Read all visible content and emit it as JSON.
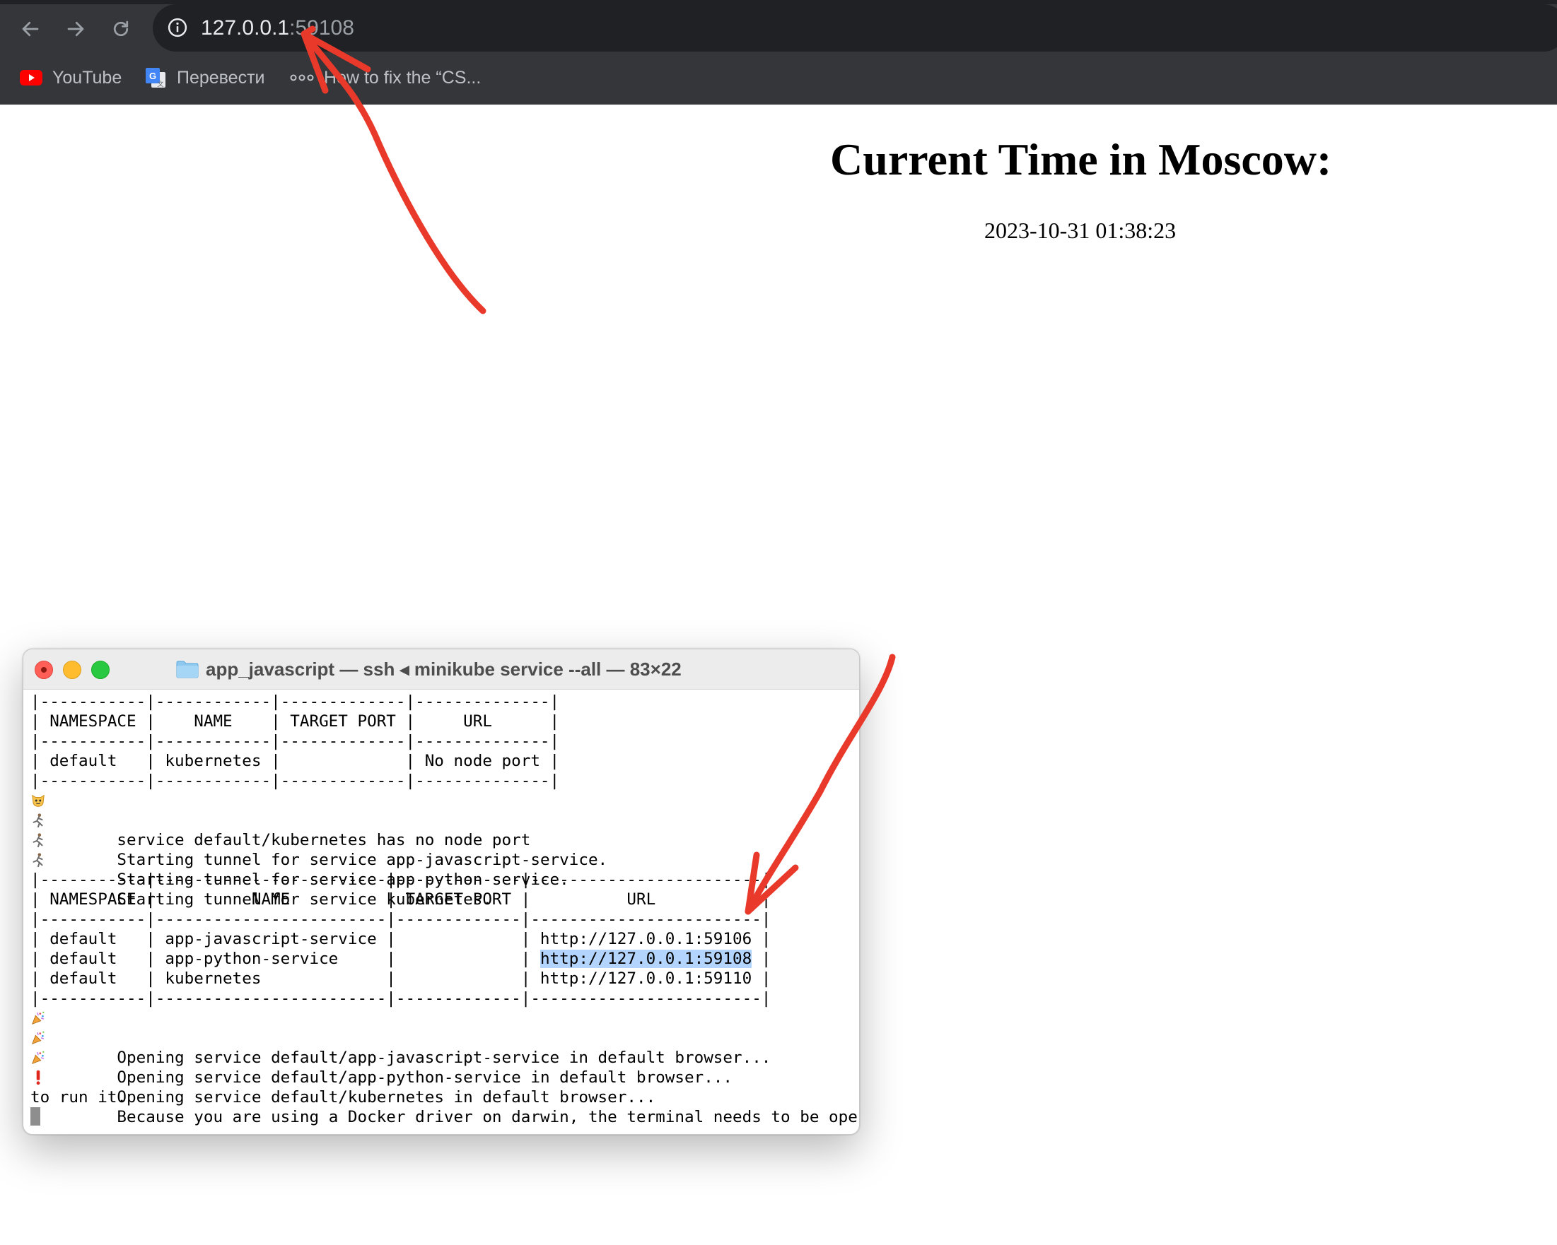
{
  "browser": {
    "url_host": "127.0.0.1",
    "url_port": ":59108",
    "bookmarks": [
      {
        "label": "YouTube",
        "icon": "youtube-icon"
      },
      {
        "label": "Перевести",
        "icon": "google-translate-icon"
      },
      {
        "label": "How to fix the “CS...",
        "icon": "ellipsis-icon"
      }
    ],
    "nav_icons": [
      "back-arrow-icon",
      "forward-arrow-icon",
      "reload-icon",
      "info-icon"
    ]
  },
  "page": {
    "heading": "Current Time in Moscow:",
    "time": "2023-10-31 01:38:23"
  },
  "terminal": {
    "title": "app_javascript — ssh ◂ minikube service --all — 83×22",
    "lines": [
      {
        "text": "|-----------|------------|-------------|--------------|"
      },
      {
        "text": "| NAMESPACE |    NAME    | TARGET PORT |     URL      |"
      },
      {
        "text": "|-----------|------------|-------------|--------------|"
      },
      {
        "text": "| default   | kubernetes |             | No node port |"
      },
      {
        "text": "|-----------|------------|-------------|--------------|"
      },
      {
        "text": "   service default/kubernetes has no node port",
        "emoji": "cat-face-icon"
      },
      {
        "text": "   Starting tunnel for service app-javascript-service.",
        "emoji": "running-person-icon"
      },
      {
        "text": "   Starting tunnel for service app-python-service.",
        "emoji": "running-person-icon"
      },
      {
        "text": "   Starting tunnel for service kubernetes.",
        "emoji": "running-person-icon"
      },
      {
        "text": "|-----------|------------------------|-------------|------------------------|"
      },
      {
        "text": "| NAMESPACE |          NAME          | TARGET PORT |          URL           |"
      },
      {
        "text": "|-----------|------------------------|-------------|------------------------|"
      },
      {
        "text": "| default   | app-javascript-service |             | http://127.0.0.1:59106 |"
      },
      {
        "text_before": "| default   | app-python-service     |             | ",
        "text_highlight": "http://127.0.0.1:59108",
        "text_after": " |"
      },
      {
        "text": "| default   | kubernetes             |             | http://127.0.0.1:59110 |"
      },
      {
        "text": "|-----------|------------------------|-------------|------------------------|"
      },
      {
        "text": "   Opening service default/app-javascript-service in default browser...",
        "emoji": "party-popper-icon"
      },
      {
        "text": "   Opening service default/app-python-service in default browser...",
        "emoji": "party-popper-icon"
      },
      {
        "text": "   Opening service default/kubernetes in default browser...",
        "emoji": "party-popper-icon"
      },
      {
        "text": "   Because you are using a Docker driver on darwin, the terminal needs to be open",
        "emoji": "exclamation-icon"
      },
      {
        "text": "to run it."
      }
    ]
  },
  "colors": {
    "chrome_bg": "#35363a",
    "omnibox_bg": "#202124",
    "selection_highlight": "#b3d4fc",
    "annotation_red": "#e8392a"
  }
}
